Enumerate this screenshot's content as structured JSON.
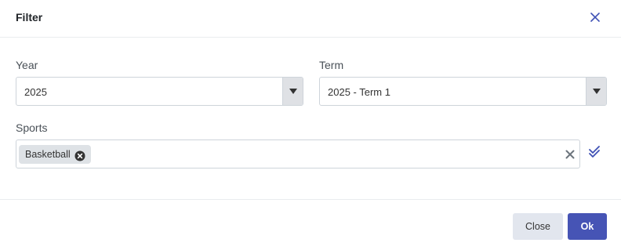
{
  "dialog": {
    "title": "Filter"
  },
  "icons": {
    "close": "close-icon",
    "dropdown": "triangle-down-icon",
    "chip_remove": "circle-x-icon",
    "clear": "x-icon",
    "select_all": "double-check-icon"
  },
  "fields": {
    "year": {
      "label": "Year",
      "value": "2025"
    },
    "term": {
      "label": "Term",
      "value": "2025 - Term 1"
    },
    "sports": {
      "label": "Sports",
      "selected": [
        "Basketball"
      ]
    }
  },
  "footer": {
    "close_label": "Close",
    "ok_label": "Ok"
  },
  "colors": {
    "accent": "#4654b5",
    "icon_blue": "#3f51b5",
    "border": "#ced4da"
  }
}
